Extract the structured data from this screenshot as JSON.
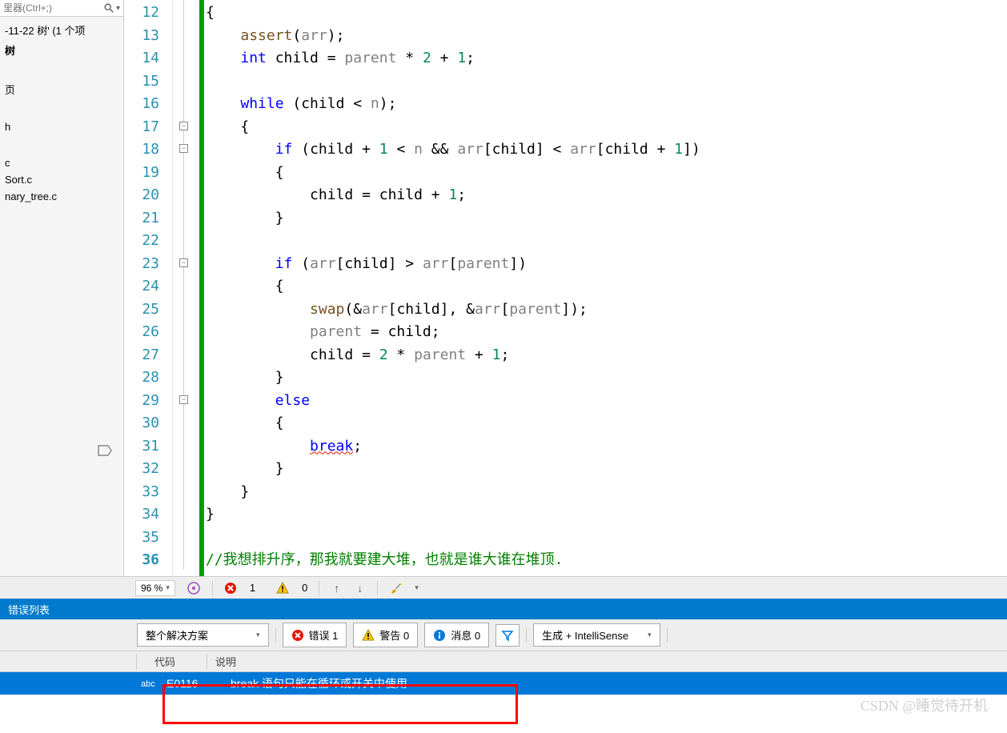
{
  "sidebar": {
    "search_placeholder": "里器(Ctrl+;)",
    "items": [
      {
        "label": "-11-22 树' (1 个项"
      },
      {
        "label": "树"
      },
      {
        "label": "页"
      },
      {
        "label": "h"
      },
      {
        "label": "c"
      },
      {
        "label": "Sort.c"
      },
      {
        "label": "nary_tree.c"
      }
    ]
  },
  "editor": {
    "zoom": "96 %",
    "lines": [
      {
        "n": 12,
        "tokens": [
          {
            "t": "{",
            "c": ""
          }
        ]
      },
      {
        "n": 13,
        "tokens": [
          {
            "t": "    ",
            "c": ""
          },
          {
            "t": "assert",
            "c": "fn"
          },
          {
            "t": "(",
            "c": ""
          },
          {
            "t": "arr",
            "c": "param"
          },
          {
            "t": ");",
            "c": ""
          }
        ]
      },
      {
        "n": 14,
        "tokens": [
          {
            "t": "    ",
            "c": ""
          },
          {
            "t": "int",
            "c": "type"
          },
          {
            "t": " child = ",
            "c": ""
          },
          {
            "t": "parent",
            "c": "param"
          },
          {
            "t": " * ",
            "c": ""
          },
          {
            "t": "2",
            "c": "num"
          },
          {
            "t": " + ",
            "c": ""
          },
          {
            "t": "1",
            "c": "num"
          },
          {
            "t": ";",
            "c": ""
          }
        ]
      },
      {
        "n": 15,
        "tokens": []
      },
      {
        "n": 16,
        "tokens": [
          {
            "t": "    ",
            "c": ""
          },
          {
            "t": "while",
            "c": "kw"
          },
          {
            "t": " (child < ",
            "c": ""
          },
          {
            "t": "n",
            "c": "param"
          },
          {
            "t": ");",
            "c": ""
          }
        ]
      },
      {
        "n": 17,
        "tokens": [
          {
            "t": "    {",
            "c": ""
          }
        ]
      },
      {
        "n": 18,
        "tokens": [
          {
            "t": "        ",
            "c": ""
          },
          {
            "t": "if",
            "c": "kw"
          },
          {
            "t": " (child + ",
            "c": ""
          },
          {
            "t": "1",
            "c": "num"
          },
          {
            "t": " < ",
            "c": ""
          },
          {
            "t": "n",
            "c": "param"
          },
          {
            "t": " && ",
            "c": ""
          },
          {
            "t": "arr",
            "c": "param"
          },
          {
            "t": "[child] < ",
            "c": ""
          },
          {
            "t": "arr",
            "c": "param"
          },
          {
            "t": "[child + ",
            "c": ""
          },
          {
            "t": "1",
            "c": "num"
          },
          {
            "t": "])",
            "c": ""
          }
        ]
      },
      {
        "n": 19,
        "tokens": [
          {
            "t": "        {",
            "c": ""
          }
        ]
      },
      {
        "n": 20,
        "tokens": [
          {
            "t": "            child = child + ",
            "c": ""
          },
          {
            "t": "1",
            "c": "num"
          },
          {
            "t": ";",
            "c": ""
          }
        ]
      },
      {
        "n": 21,
        "tokens": [
          {
            "t": "        }",
            "c": ""
          }
        ]
      },
      {
        "n": 22,
        "tokens": []
      },
      {
        "n": 23,
        "tokens": [
          {
            "t": "        ",
            "c": ""
          },
          {
            "t": "if",
            "c": "kw"
          },
          {
            "t": " (",
            "c": ""
          },
          {
            "t": "arr",
            "c": "param"
          },
          {
            "t": "[child] > ",
            "c": ""
          },
          {
            "t": "arr",
            "c": "param"
          },
          {
            "t": "[",
            "c": ""
          },
          {
            "t": "parent",
            "c": "param"
          },
          {
            "t": "])",
            "c": ""
          }
        ]
      },
      {
        "n": 24,
        "tokens": [
          {
            "t": "        {",
            "c": ""
          }
        ]
      },
      {
        "n": 25,
        "tokens": [
          {
            "t": "            ",
            "c": ""
          },
          {
            "t": "swap",
            "c": "fn"
          },
          {
            "t": "(&",
            "c": ""
          },
          {
            "t": "arr",
            "c": "param"
          },
          {
            "t": "[child], &",
            "c": ""
          },
          {
            "t": "arr",
            "c": "param"
          },
          {
            "t": "[",
            "c": ""
          },
          {
            "t": "parent",
            "c": "param"
          },
          {
            "t": "]);",
            "c": ""
          }
        ]
      },
      {
        "n": 26,
        "tokens": [
          {
            "t": "            ",
            "c": ""
          },
          {
            "t": "parent",
            "c": "param"
          },
          {
            "t": " = child;",
            "c": ""
          }
        ]
      },
      {
        "n": 27,
        "tokens": [
          {
            "t": "            child = ",
            "c": ""
          },
          {
            "t": "2",
            "c": "num"
          },
          {
            "t": " * ",
            "c": ""
          },
          {
            "t": "parent",
            "c": "param"
          },
          {
            "t": " + ",
            "c": ""
          },
          {
            "t": "1",
            "c": "num"
          },
          {
            "t": ";",
            "c": ""
          }
        ]
      },
      {
        "n": 28,
        "tokens": [
          {
            "t": "        }",
            "c": ""
          }
        ]
      },
      {
        "n": 29,
        "tokens": [
          {
            "t": "        ",
            "c": ""
          },
          {
            "t": "else",
            "c": "kw"
          }
        ]
      },
      {
        "n": 30,
        "tokens": [
          {
            "t": "        {",
            "c": ""
          }
        ]
      },
      {
        "n": 31,
        "tokens": [
          {
            "t": "            ",
            "c": ""
          },
          {
            "t": "break",
            "c": "kw squiggle"
          },
          {
            "t": ";",
            "c": ""
          }
        ]
      },
      {
        "n": 32,
        "tokens": [
          {
            "t": "        }",
            "c": ""
          }
        ]
      },
      {
        "n": 33,
        "tokens": [
          {
            "t": "    }",
            "c": ""
          }
        ]
      },
      {
        "n": 34,
        "tokens": [
          {
            "t": "}",
            "c": ""
          }
        ]
      },
      {
        "n": 35,
        "tokens": []
      },
      {
        "n": 36,
        "bold": true,
        "tokens": [
          {
            "t": "//我想排升序，那我就要建大堆，也就是谁大谁在堆顶.",
            "c": "comment"
          }
        ]
      }
    ]
  },
  "status": {
    "error_count": "1",
    "warning_count": "0"
  },
  "panel": {
    "title": "错误列表",
    "scope": "整个解决方案",
    "errors_label": "错误 1",
    "warnings_label": "警告 0",
    "messages_label": "消息 0",
    "build_source": "生成 + IntelliSense",
    "col_code": "代码",
    "col_desc": "说明",
    "row": {
      "code": "E0116",
      "desc": "break 语句只能在循环或开关中使用"
    }
  },
  "watermark": "CSDN @睡觉待开机"
}
